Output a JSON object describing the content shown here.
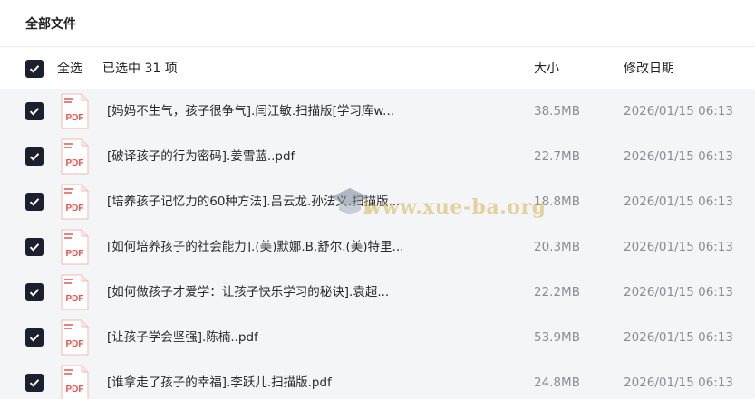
{
  "page": {
    "title": "全部文件"
  },
  "header": {
    "select_all_label": "全选",
    "selected_count": "已选中 31 项",
    "col_size": "大小",
    "col_date": "修改日期"
  },
  "files": [
    {
      "name": "[妈妈不生气，孩子很争气].闫江敏.扫描版[学习库w...",
      "size": "38.5MB",
      "date": "2026/01/15 06:13",
      "icon": "pdf-icon",
      "icon_label": "PDF"
    },
    {
      "name": "[破译孩子的行为密码].姜雪蓝..pdf",
      "size": "22.7MB",
      "date": "2026/01/15 06:13",
      "icon": "pdf-icon",
      "icon_label": "PDF"
    },
    {
      "name": "[培养孩子记忆力的60种方法].吕云龙.孙法义.扫描版....",
      "size": "18.8MB",
      "date": "2026/01/15 06:13",
      "icon": "pdf-icon",
      "icon_label": "PDF"
    },
    {
      "name": "[如何培养孩子的社会能力].(美)默娜.B.舒尔.(美)特里...",
      "size": "20.3MB",
      "date": "2026/01/15 06:13",
      "icon": "pdf-icon",
      "icon_label": "PDF"
    },
    {
      "name": "[如何做孩子才爱学：让孩子快乐学习的秘诀].袁超...",
      "size": "22.2MB",
      "date": "2026/01/15 06:13",
      "icon": "pdf-icon",
      "icon_label": "PDF"
    },
    {
      "name": "[让孩子学会坚强].陈楠..pdf",
      "size": "53.9MB",
      "date": "2026/01/15 06:13",
      "icon": "pdf-icon",
      "icon_label": "PDF"
    },
    {
      "name": "[谁拿走了孩子的幸福].李跃儿.扫描版.pdf",
      "size": "24.8MB",
      "date": "2026/01/15 06:13",
      "icon": "pdf-icon",
      "icon_label": "PDF"
    }
  ],
  "watermark": {
    "text": "www.xue-ba.org"
  },
  "colors": {
    "checkbox": "#1b1f2e",
    "pdf_red": "#e8554e",
    "list_bg": "#f4f5f7",
    "meta_text": "#8a8d93"
  }
}
